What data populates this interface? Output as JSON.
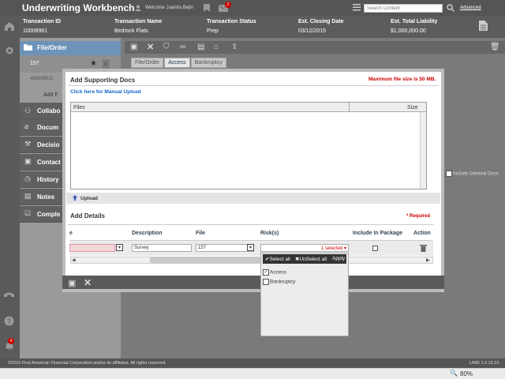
{
  "app": {
    "title": "Underwriting Workbench",
    "welcome": "Welcome Juanita Bejin",
    "notification_count": "2",
    "search_placeholder": "Search Content",
    "advanced_link": "Advanced"
  },
  "transaction": {
    "headers": [
      "Transaction ID",
      "Transaction Name",
      "Transaction Status",
      "Est. Closing Date",
      "Est. Total Liability"
    ],
    "values": [
      "10008961",
      "Bedrock Flats",
      "Prep",
      "03/12/2015",
      "$1,000,000.00"
    ]
  },
  "left_panel": {
    "title": "File/Order",
    "order_number": "157",
    "sub_id": "484598511",
    "add_label": "Add F",
    "nav": [
      "Collabo",
      "Docum",
      "Decisio",
      "Contact",
      "History",
      "Notes",
      "Comple"
    ]
  },
  "main": {
    "tabs": [
      "File/Order",
      "Access",
      "Bankruptcy"
    ],
    "active_tab": "Access",
    "include_general_docs": "Include General Docs"
  },
  "modal": {
    "title": "Add Supporting Docs",
    "max_size": "Maximum file size is 50 MB.",
    "manual_upload": "Click here for Manual Upload",
    "files_col": "Files",
    "size_col": "Size",
    "upload_label": "Upload",
    "add_details": "Add Details",
    "required": "* Required",
    "columns": [
      "e",
      "Description",
      "File",
      "Risk(s)",
      "Include In Package",
      "Action"
    ],
    "row": {
      "description": "Survey",
      "file": "157",
      "risks": "1 selected"
    }
  },
  "risk_dropdown": {
    "select_all": "Select all",
    "unselect_all": "UnSelect all",
    "apply": "Apply",
    "options": [
      {
        "label": "Access",
        "checked": true
      },
      {
        "label": "Bankruptcy",
        "checked": false
      }
    ]
  },
  "footer": {
    "copyright": "©2015 First American Financial Corporation and/or its affiliates. All rights reserved.",
    "version": "UWB 1.0.15.10"
  },
  "status": {
    "zoom": "80%"
  }
}
